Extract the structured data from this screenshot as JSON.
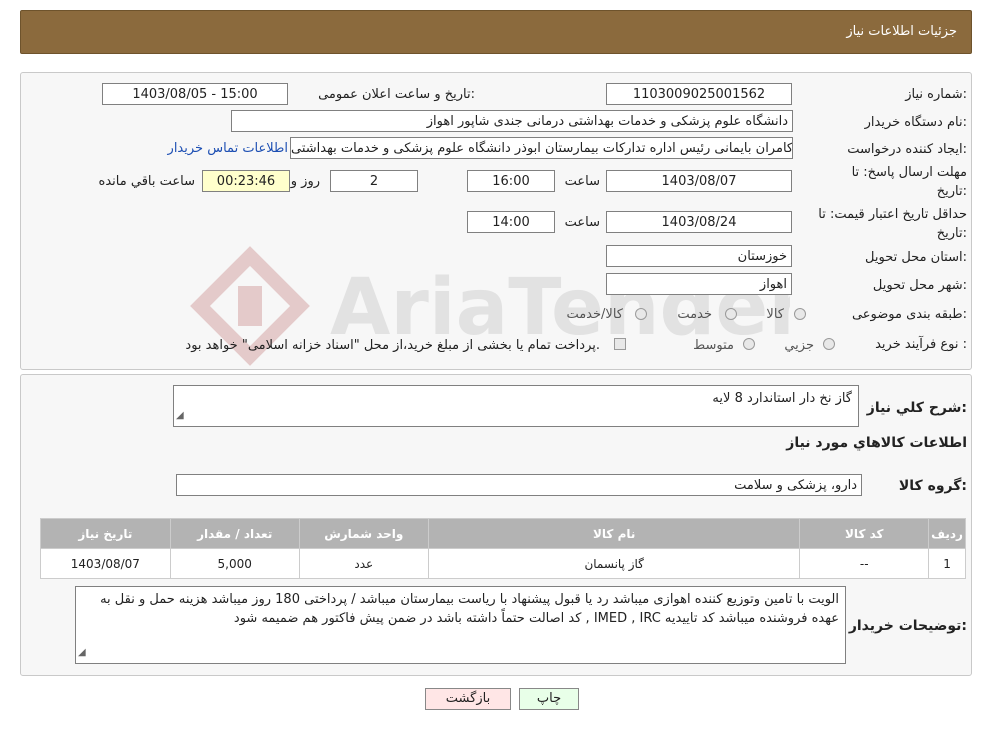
{
  "header": {
    "title": "جزئیات اطلاعات نیاز"
  },
  "form": {
    "need_number_label": "شماره نیاز:",
    "need_number": "1103009025001562",
    "announce_label": "تاریخ و ساعت اعلان عمومی:",
    "announce_value": "1403/08/05 - 15:00",
    "buyer_org_label": "نام دستگاه خریدار:",
    "buyer_org": "دانشگاه علوم پزشکی و خدمات بهداشتی درمانی جندی شاپور اهواز",
    "creator_label": "ایجاد کننده درخواست:",
    "creator": "کامران بایمانی رئیس اداره تدارکات بیمارستان ابوذر  دانشگاه علوم پزشکی و خدمات بهداشتی",
    "contact_link": "اطلاعات تماس خریدار",
    "deadline_label_1": "مهلت ارسال پاسخ: تا",
    "deadline_label_2": "تاریخ:",
    "deadline_date": "1403/08/07",
    "time_word": "ساعت",
    "deadline_time": "16:00",
    "days_value": "2",
    "days_word": "روز و",
    "remaining_time": "00:23:46",
    "remaining_word": "ساعت باقي مانده",
    "validity_label_1": "حداقل تاریخ اعتبار قیمت: تا",
    "validity_label_2": "تاریخ:",
    "validity_date": "1403/08/24",
    "validity_time": "14:00",
    "province_label": "استان محل تحویل:",
    "province": "خوزستان",
    "city_label": "شهر محل تحویل:",
    "city": "اهواز",
    "category_label": "طبقه بندی موضوعی:",
    "category_options": [
      "کالا",
      "خدمت",
      "کالا/خدمت"
    ],
    "process_label": "نوع فرآیند خرید :",
    "process_options": [
      "جزیي",
      "متوسط"
    ],
    "payment_note": "پرداخت تمام یا بخشی از مبلغ خرید،از محل \"اسناد خزانه اسلامی\" خواهد بود."
  },
  "details": {
    "summary_label": "شرح کلي نیاز:",
    "summary": "گاز نخ دار استاندارد 8 لایه",
    "goods_info_title": "اطلاعات کالاهاي مورد نیاز",
    "goods_group_label": "گروه کالا:",
    "goods_group": "دارو، پزشکی و سلامت",
    "table_headers": [
      "ردیف",
      "کد کالا",
      "نام کالا",
      "واحد شمارش",
      "تعداد / مقدار",
      "تاریخ نیاز"
    ],
    "rows": [
      {
        "row": "1",
        "code": "--",
        "name": "گاز پانسمان",
        "unit": "عدد",
        "qty": "5,000",
        "date": "1403/08/07"
      }
    ],
    "buyer_notes_label": "توضیحات خریدار:",
    "buyer_notes": "الویت با تامین وتوزیع کننده اهوازی  میباشد رد یا قبول پیشنهاد با ریاست بیمارستان میباشد / پرداختی 180 روز   میباشد هزینه حمل و نقل به عهده فروشنده میباشد   کد تاییدیه IMED , IRC , کد اصالت حتماً داشته باشد در ضمن پیش فاکتور هم ضمیمه شود"
  },
  "buttons": {
    "print": "چاپ",
    "back": "بازگشت"
  },
  "watermark_text": "AriaTender.neT",
  "colors": {
    "header_bg": "#8b6a3d",
    "link": "#1d4fb3",
    "back_button_bg": "#ffe6e6",
    "print_button_bg": "#e8ffe8"
  }
}
